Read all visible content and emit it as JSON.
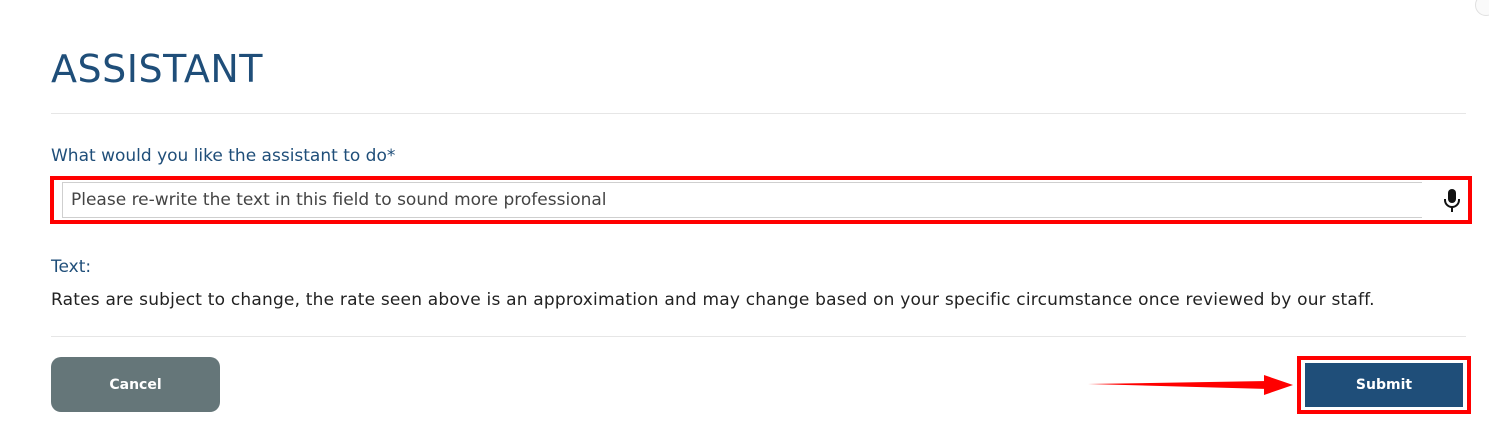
{
  "page": {
    "title": "ASSISTANT"
  },
  "prompt_field": {
    "label": "What would you like the assistant to do*",
    "value": "Please re-write the text in this field to sound more professional",
    "mic_icon": "microphone-icon"
  },
  "text_section": {
    "label": "Text:",
    "body": "Rates are subject to change, the rate seen above is an approximation and may change based on your specific circumstance once reviewed by our staff."
  },
  "actions": {
    "cancel_label": "Cancel",
    "submit_label": "Submit"
  },
  "colors": {
    "accent": "#1f4e79",
    "cancel_bg": "#657679",
    "highlight": "#ff0000"
  }
}
